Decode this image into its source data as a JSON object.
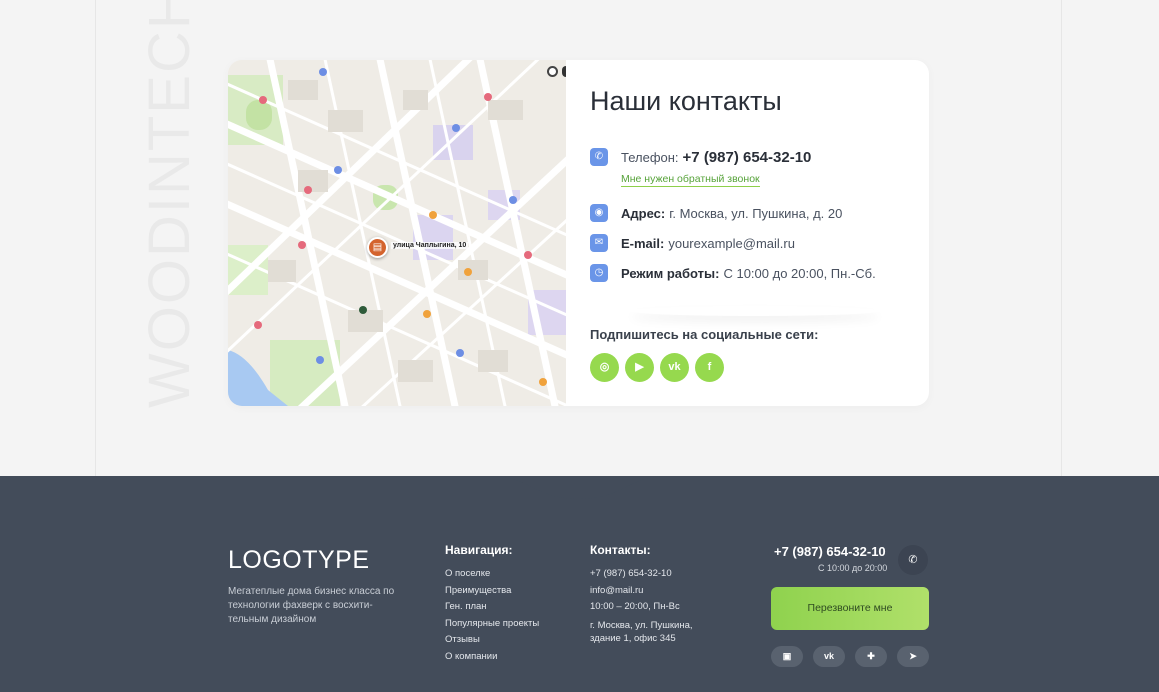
{
  "watermark": "WOODINTECH",
  "map": {
    "pin_label": "улица Чаплыгина, 10"
  },
  "contacts": {
    "title": "Наши контакты",
    "phone_label": "Телефон:",
    "phone_value": "+7 (987) 654-32-10",
    "callback_link": "Мне нужен обратный звонок",
    "address_label": "Адрес:",
    "address_value": "г. Москва, ул. Пушкина, д. 20",
    "email_label": "E-mail:",
    "email_value": "yourexample@mail.ru",
    "hours_label": "Режим работы:",
    "hours_value": "С 10:00 до 20:00, Пн.-Сб.",
    "social_title": "Подпишитесь на социальные сети:",
    "social": [
      "instagram",
      "youtube",
      "vk",
      "facebook"
    ]
  },
  "footer": {
    "logo": "LOGOTYPE",
    "tagline": "Мегатеплые дома бизнес класса по технологии фахверк с восхити-тельным дизайном",
    "nav_title": "Навигация:",
    "nav_items": [
      "О поселке",
      "Преимущества",
      "Ген. план",
      "Популярные проекты",
      "Отзывы",
      "О компании"
    ],
    "contacts_title": "Контакты:",
    "contact_items": [
      "+7 (987) 654-32-10",
      "info@mail.ru",
      "10:00 – 20:00, Пн-Вс",
      "г. Москва, ул. Пушкина, здание 1, офис 345"
    ],
    "phone": "+7 (987) 654-32-10",
    "hours": "С 10:00 до 20:00",
    "cta": "Перезвоните мне",
    "social": [
      "youtube",
      "vk",
      "plus",
      "telegram"
    ]
  },
  "colors": {
    "accent": "#96d94e",
    "footer_bg": "#434c5a",
    "icon_blue": "#6a95e8"
  }
}
